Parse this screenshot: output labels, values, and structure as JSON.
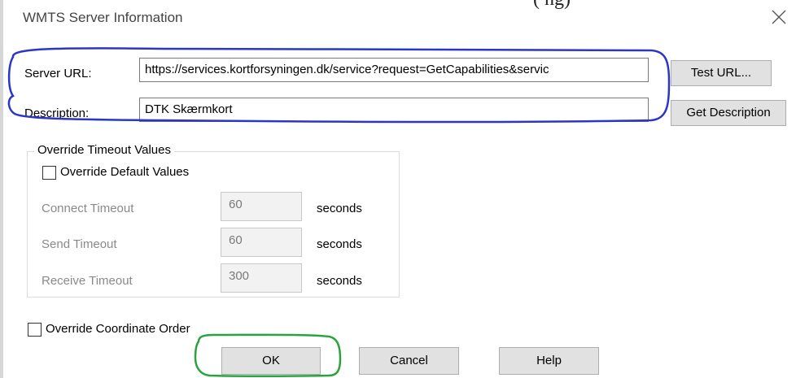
{
  "window": {
    "title": "WMTS Server Information",
    "clipped_top_text": "(       ng)"
  },
  "server": {
    "url_label": "Server URL:",
    "url_value": "https://services.kortforsyningen.dk/service?request=GetCapabilities&servic",
    "description_label": "Description:",
    "description_value": "DTK Skærmkort",
    "test_url_label": "Test URL...",
    "get_description_label": "Get Description"
  },
  "timeouts": {
    "group_label": "Override Timeout Values",
    "override_default_label": "Override Default Values",
    "override_default_checked": false,
    "connect_label": "Connect Timeout",
    "connect_value": "60",
    "send_label": "Send Timeout",
    "send_value": "60",
    "receive_label": "Receive Timeout",
    "receive_value": "300",
    "unit": "seconds"
  },
  "coordinate_order": {
    "label": "Override Coordinate Order",
    "checked": false
  },
  "footer": {
    "ok_label": "OK",
    "cancel_label": "Cancel",
    "help_label": "Help"
  },
  "colors": {
    "highlight_blue": "#2b36c8",
    "highlight_green": "#2aa33f",
    "button_face": "#e1e1e1",
    "disabled_text": "#8a8a8a"
  }
}
